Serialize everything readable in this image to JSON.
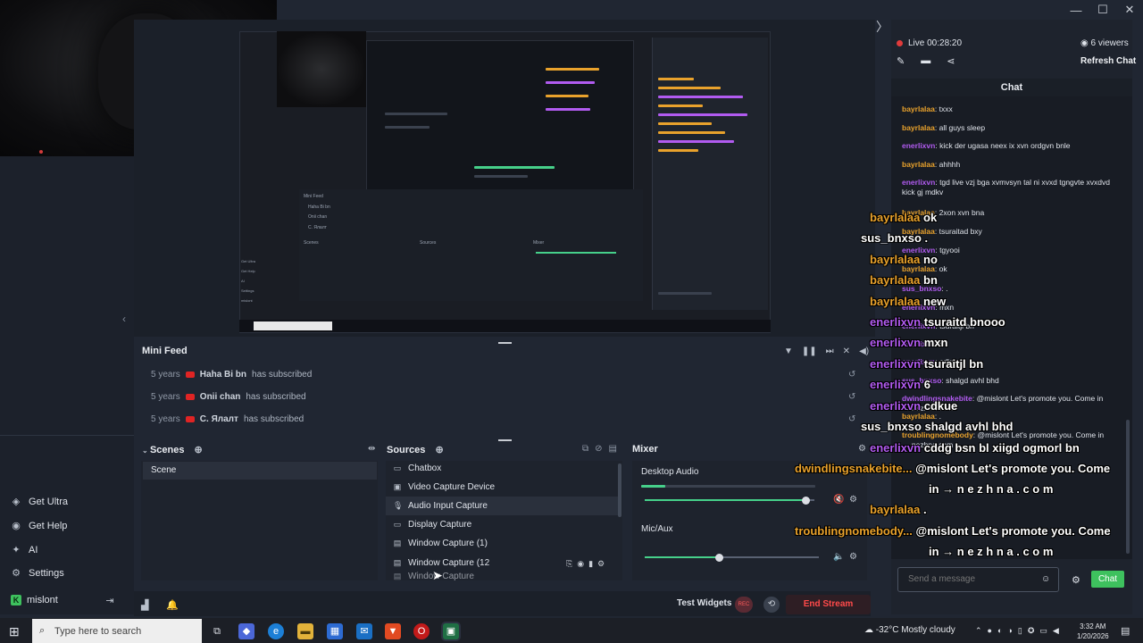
{
  "window": {
    "minimize": "—",
    "maximize": "☐",
    "close": "✕",
    "expand": "〉"
  },
  "left_nav": {
    "items": [
      {
        "label": "Get Ultra",
        "icon": "ultra-icon"
      },
      {
        "label": "Get Help",
        "icon": "help-icon"
      },
      {
        "label": "AI",
        "icon": "ai-sparkle-icon"
      },
      {
        "label": "Settings",
        "icon": "gear-icon"
      }
    ],
    "user": "mislont",
    "user_badge": "K"
  },
  "mini_feed": {
    "title": "Mini Feed",
    "events": [
      {
        "time": "5 years",
        "name": "Haha Bi bn",
        "action": "has subscribed"
      },
      {
        "time": "5 years",
        "name": "Onii chan",
        "action": "has subscribed"
      },
      {
        "time": "5 years",
        "name": "C. Ялалт",
        "action": "has subscribed"
      }
    ]
  },
  "scenes": {
    "title": "Scenes",
    "items": [
      "Scene"
    ]
  },
  "sources": {
    "title": "Sources",
    "items": [
      {
        "label": "Chatbox",
        "icon": "browser-icon"
      },
      {
        "label": "Video Capture Device",
        "icon": "camera-icon"
      },
      {
        "label": "Audio Input Capture",
        "icon": "mic-icon"
      },
      {
        "label": "Display Capture",
        "icon": "monitor-icon"
      },
      {
        "label": "Window Capture (1)",
        "icon": "window-icon"
      },
      {
        "label": "Window Capture (12",
        "icon": "window-icon"
      },
      {
        "label": "Window Capture",
        "icon": "window-icon"
      }
    ]
  },
  "mixer": {
    "title": "Mixer",
    "channels": [
      {
        "label": "Desktop Audio",
        "level": 0.14,
        "volume": 0.95
      },
      {
        "label": "Mic/Aux",
        "level": 0.0,
        "volume": 0.43
      }
    ]
  },
  "bottom": {
    "test_widgets": "Test Widgets",
    "rec": "REC",
    "end_stream": "End Stream"
  },
  "stream": {
    "live_time": "Live 00:28:20",
    "viewers": "6 viewers",
    "refresh_chat": "Refresh Chat"
  },
  "chat": {
    "title": "Chat",
    "messages": [
      {
        "user": "bayrlalaa",
        "color": "yellow",
        "text": "txxx"
      },
      {
        "user": "bayrlalaa",
        "color": "yellow",
        "text": "all guys sleep"
      },
      {
        "user": "enerlixvn",
        "color": "purple",
        "text": "kick der ugasa neex ix xvn ordgvn bnle"
      },
      {
        "user": "bayrlalaa",
        "color": "yellow",
        "text": "ahhhh"
      },
      {
        "user": "enerlixvn",
        "color": "purple",
        "text": "tgd live vzj bga xvmvsyn tal ni xvxd tgngvte xvxdvd kick gj mdkv"
      },
      {
        "user": "bayrlalaa",
        "color": "yellow",
        "text": "2xon xvn bna"
      },
      {
        "user": "bayrlalaa",
        "color": "yellow",
        "text": "tsuraitad bxy"
      },
      {
        "user": "enerlixvn",
        "color": "purple",
        "text": "tgyooi"
      },
      {
        "user": "bayrlalaa",
        "color": "yellow",
        "text": "ok"
      },
      {
        "user": "sus_bnxso",
        "color": "white",
        "text": "."
      },
      {
        "user": "enerlixvn",
        "color": "purple",
        "text": "mxn"
      },
      {
        "user": "enerlixvn",
        "color": "purple",
        "text": "tsuraitjl bn"
      },
      {
        "user": "enerlixvn",
        "color": "purple",
        "text": "6"
      },
      {
        "user": "enerlixvn",
        "color": "purple",
        "text": "cdkue"
      },
      {
        "user": "sus_bnxso",
        "color": "white",
        "text": "shalgd avhl bhd"
      },
      {
        "user": "dwindlingsnakebite",
        "color": "white",
        "text": "@mislont Let's promote you. Come in → nezhna.com"
      },
      {
        "user": "bayrlalaa",
        "color": "yellow",
        "text": "."
      },
      {
        "user": "troublingnomebody",
        "color": "yellow",
        "text": "@mislont Let's promote you. Come in → nezhna.com"
      }
    ],
    "placeholder": "Send a message",
    "send_label": "Chat"
  },
  "overlay_chat": [
    {
      "user": "bayrlalaa",
      "color": "yellow",
      "text": "ok"
    },
    {
      "user": "sus_bnxso",
      "color": "white",
      "text": "."
    },
    {
      "user": "bayrlalaa",
      "color": "yellow",
      "text": "no"
    },
    {
      "user": "bayrlalaa",
      "color": "yellow",
      "text": "bn"
    },
    {
      "user": "bayrlalaa",
      "color": "yellow",
      "text": "new"
    },
    {
      "user": "enerlixvn",
      "color": "purple",
      "text": "tsuraitd bnooo"
    },
    {
      "user": "enerlixvn",
      "color": "purple",
      "text": "mxn"
    },
    {
      "user": "enerlixvn",
      "color": "purple",
      "text": "tsuraitjl bn"
    },
    {
      "user": "enerlixvn",
      "color": "purple",
      "text": "6"
    },
    {
      "user": "enerlixvn",
      "color": "purple",
      "text": "cdkue"
    },
    {
      "user": "sus_bnxso",
      "color": "white",
      "text": "shalgd avhl bhd"
    },
    {
      "user": "enerlixvn",
      "color": "purple",
      "text": "cddg bsn bl xiigd ogmorl bn"
    },
    {
      "user": "dwindlingsnakebite...",
      "color": "yellow",
      "text": "@mislont Let's promote you. Come"
    },
    {
      "user": "",
      "color": "white",
      "text": "in → n e z h n a . c o m"
    },
    {
      "user": "bayrlalaa",
      "color": "yellow",
      "text": "."
    },
    {
      "user": "troublingnomebody...",
      "color": "yellow",
      "text": "@mislont Let's promote you. Come"
    },
    {
      "user": "",
      "color": "white",
      "text": "in → n e z h n a . c o m"
    }
  ],
  "taskbar": {
    "search_placeholder": "Type here to search",
    "weather": "-32°C  Mostly cloudy",
    "time": "3:32 AM",
    "date": "1/20/2026"
  },
  "colors": {
    "accent_green": "#3ec15e",
    "live_red": "#e03b3b",
    "user_yellow": "#e9a22c",
    "user_purple": "#b15bf0"
  }
}
